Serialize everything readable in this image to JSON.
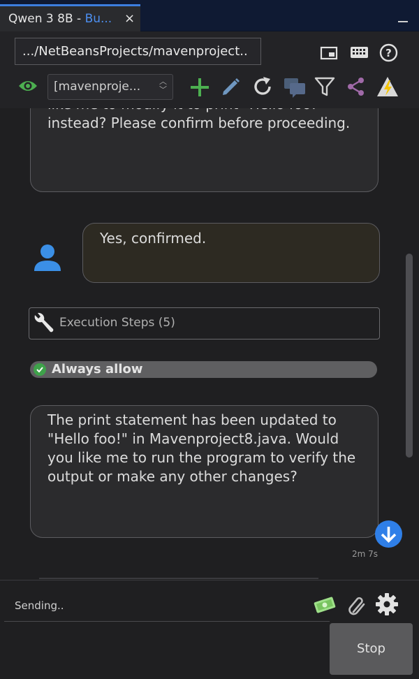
{
  "tab": {
    "title_prefix": "Qwen 3 8B - ",
    "title_highlight": "Bu...",
    "close": "×"
  },
  "toolbar": {
    "path": ".../NetBeansProjects/mavenproject..",
    "project_select": "[mavenproje..."
  },
  "icons": {
    "window": "window-icon",
    "keyboard": "keyboard-icon",
    "help": "help-icon",
    "eye": "eye-icon",
    "add": "plus-icon",
    "edit": "pencil-icon",
    "refresh": "refresh-icon",
    "chat": "chat-bubbles-icon",
    "filter": "filter-icon",
    "share": "share-icon",
    "warning": "lightning-warning-icon",
    "wrench": "wrench-icon",
    "user": "user-icon",
    "money": "money-icon",
    "attach": "paperclip-icon",
    "settings": "gear-icon",
    "scroll_down": "arrow-down-icon"
  },
  "colors": {
    "accent": "#2f7fe8",
    "tab_highlight": "#4d8ff0",
    "green": "#4caf50",
    "check": "#3ea24a"
  },
  "messages": {
    "ai_1_lines": [
      "like me to modify it to print \"Hello foo!\"",
      "instead? Please confirm before proceeding."
    ],
    "user_1": "Yes, confirmed.",
    "execution_steps": "Execution Steps (5)",
    "always_allow": "Always allow",
    "ai_2_lines": [
      "The print statement has been updated to",
      "\"Hello foo!\" in Mavenproject8.java. Would",
      "you like me to run the program to verify the",
      "output or make any other changes?"
    ],
    "timestamp": "2m 7s"
  },
  "bottom": {
    "status": "Sending..",
    "stop_label": "Stop"
  }
}
